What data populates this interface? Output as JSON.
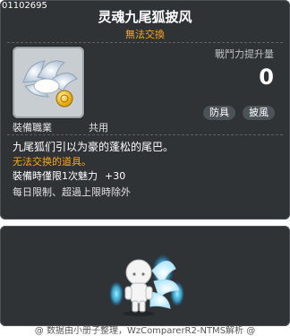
{
  "item": {
    "id": "01102695",
    "name": "灵魂九尾狐披风",
    "trade_status": "無法交換"
  },
  "stats": {
    "power_label": "戰鬥力提升量",
    "power_value": "0",
    "tags": [
      "防具",
      "披風"
    ]
  },
  "job": {
    "label": "裝備職業",
    "value": "共用"
  },
  "description": "九尾狐们引以为豪的蓬松的尾巴。",
  "warning": "无法交换的道具。",
  "bonus": {
    "text": "裝備時僅限1次魅力",
    "value": "+30"
  },
  "restriction": "每日限制、超過上限時除外",
  "footer": "@ 数据由小册子整理，WzComparerR2-NTMS解析 @",
  "colors": {
    "panel_bg": "#2f3336",
    "accent_orange": "#ffa51a"
  }
}
